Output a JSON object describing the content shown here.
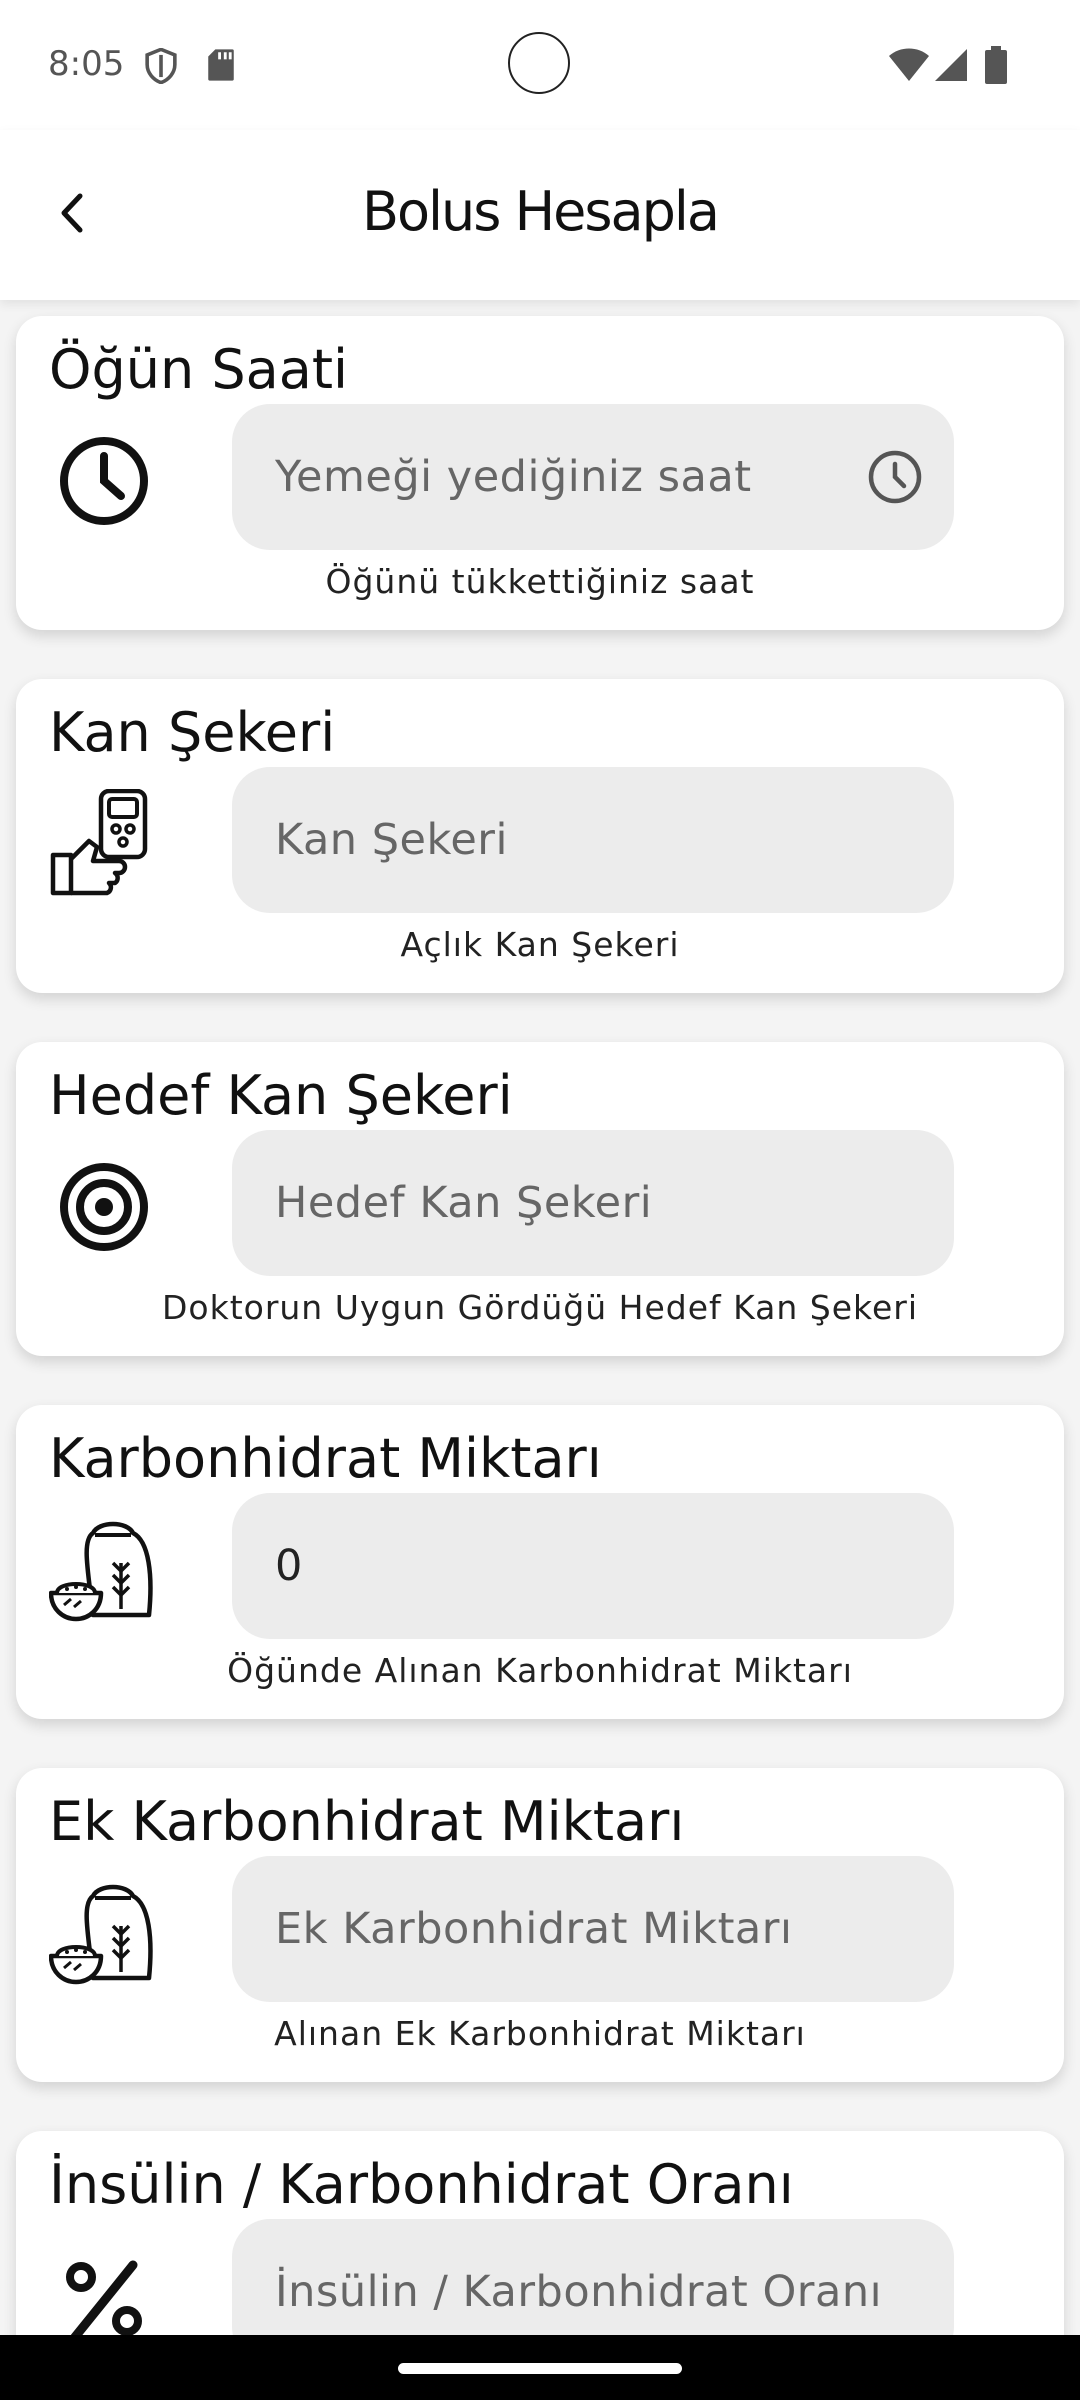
{
  "status_bar": {
    "time": "8:05",
    "icons": [
      "shield-icon",
      "sd-card-icon",
      "wifi-icon",
      "signal-icon",
      "battery-icon"
    ]
  },
  "header": {
    "title": "Bolus Hesapla",
    "back_icon": "back-arrow-icon"
  },
  "cards": [
    {
      "title": "Öğün Saati",
      "icon": "clock-icon",
      "placeholder": "Yemeği yediğiniz saat",
      "value": "",
      "trailing_icon": "clock-icon",
      "helper": "Öğünü tükkettiğiniz saat"
    },
    {
      "title": "Kan Şekeri",
      "icon": "glucose-meter-icon",
      "placeholder": "Kan Şekeri",
      "value": "",
      "helper": "Açlık Kan Şekeri"
    },
    {
      "title": "Hedef Kan Şekeri",
      "icon": "target-icon",
      "placeholder": "Hedef Kan Şekeri",
      "value": "",
      "helper": "Doktorun Uygun Gördüğü Hedef Kan Şekeri"
    },
    {
      "title": "Karbonhidrat Miktarı",
      "icon": "grain-bag-icon",
      "placeholder": "",
      "value": "0",
      "helper": "Öğünde Alınan Karbonhidrat Miktarı"
    },
    {
      "title": "Ek Karbonhidrat Miktarı",
      "icon": "grain-bag-icon",
      "placeholder": "Ek Karbonhidrat Miktarı",
      "value": "",
      "helper": "Alınan Ek Karbonhidrat Miktarı"
    },
    {
      "title": "İnsülin / Karbonhidrat Oranı",
      "icon": "percent-icon",
      "placeholder": "İnsülin / Karbonhidrat Oranı",
      "value": "",
      "helper": ""
    }
  ],
  "colors": {
    "background": "#f4f4f4",
    "card": "#ffffff",
    "field": "#ececec",
    "text": "#111111",
    "placeholder": "#666666"
  }
}
